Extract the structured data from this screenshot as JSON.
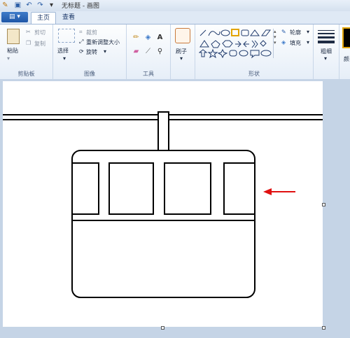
{
  "window": {
    "title": "无标题 - 画图"
  },
  "quick_access": [
    "save-icon",
    "undo-icon",
    "redo-icon",
    "customize-icon"
  ],
  "tabs": [
    {
      "label": "主页"
    },
    {
      "label": "查看"
    }
  ],
  "ribbon": {
    "clipboard": {
      "paste": "粘贴",
      "cut": "剪切",
      "copy": "复制",
      "group": "剪贴板"
    },
    "image": {
      "select": "选择",
      "crop": "裁剪",
      "resize": "重新调整大小",
      "rotate": "旋转",
      "group": "图像"
    },
    "tools": {
      "group": "工具"
    },
    "brushes": {
      "label": "刷子"
    },
    "shapes": {
      "outline": "轮廓",
      "fill": "填充",
      "group": "形状"
    },
    "size": {
      "label": "粗细"
    },
    "colors": {
      "label": "颜"
    }
  },
  "colors": {
    "accent": "#1f56a7",
    "arrow": "#e01010",
    "canvas": "#ffffff"
  }
}
